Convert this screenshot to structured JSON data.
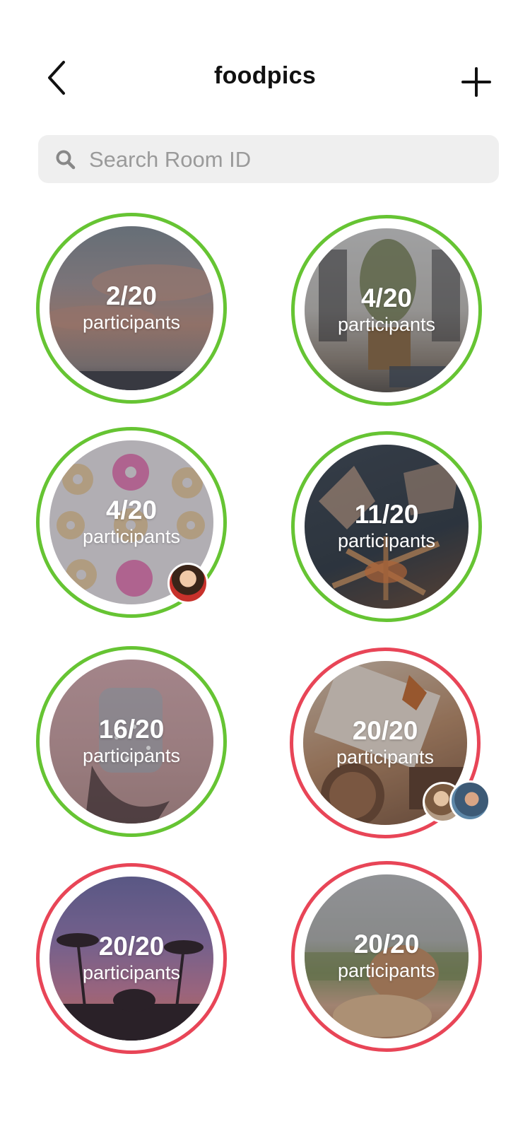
{
  "header": {
    "title": "foodpics",
    "back_icon": "chevron-left-icon",
    "add_icon": "plus-icon"
  },
  "search": {
    "placeholder": "Search Room ID",
    "value": "",
    "icon": "search-icon"
  },
  "colors": {
    "open": "#66c433",
    "full": "#e84557"
  },
  "rooms": [
    {
      "count": "2/20",
      "label": "participants",
      "status": "open"
    },
    {
      "count": "4/20",
      "label": "participants",
      "status": "open"
    },
    {
      "count": "4/20",
      "label": "participants",
      "status": "open",
      "avatars": 1
    },
    {
      "count": "11/20",
      "label": "participants",
      "status": "open"
    },
    {
      "count": "16/20",
      "label": "participants",
      "status": "open"
    },
    {
      "count": "20/20",
      "label": "participants",
      "status": "full",
      "avatars": 2
    },
    {
      "count": "20/20",
      "label": "participants",
      "status": "full"
    },
    {
      "count": "20/20",
      "label": "participants",
      "status": "full"
    }
  ]
}
